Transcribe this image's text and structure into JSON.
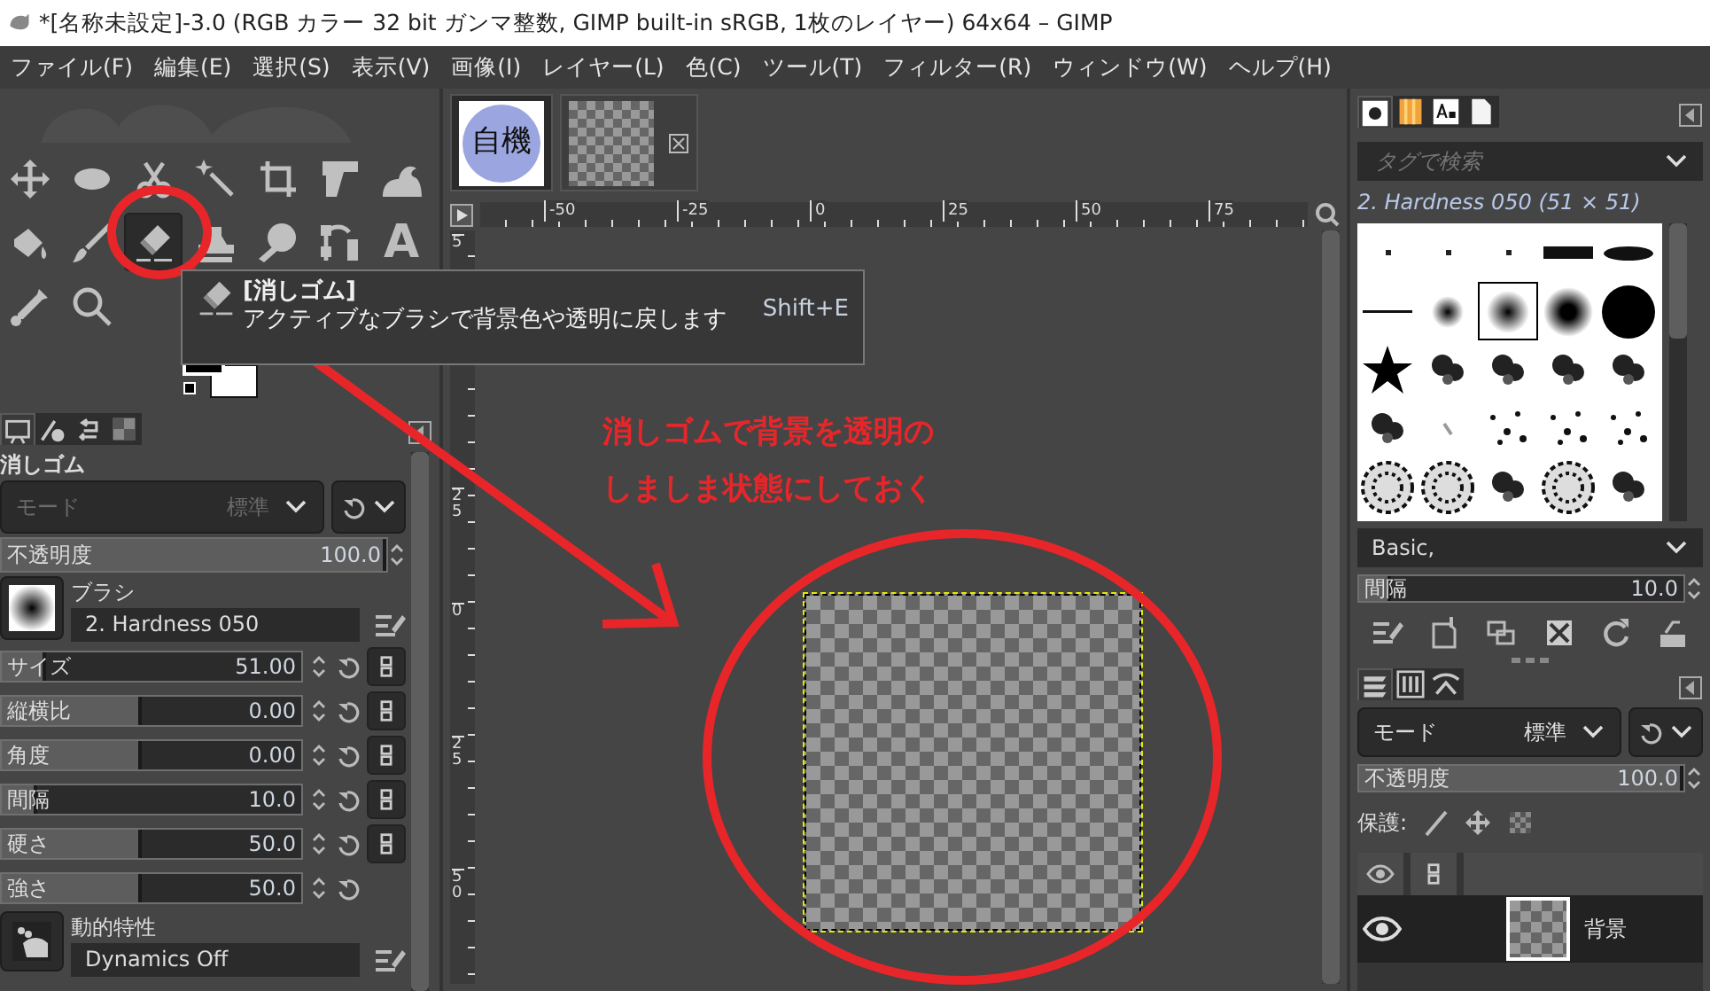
{
  "window": {
    "title": "*[名称未設定]-3.0 (RGB カラー 32 bit ガンマ整数, GIMP built-in sRGB, 1枚のレイヤー) 64x64 – GIMP"
  },
  "menu": [
    "ファイル(F)",
    "編集(E)",
    "選択(S)",
    "表示(V)",
    "画像(I)",
    "レイヤー(L)",
    "色(C)",
    "ツール(T)",
    "フィルター(R)",
    "ウィンドウ(W)",
    "ヘルプ(H)"
  ],
  "toolbox": {
    "tools": [
      {
        "kind": "move",
        "selected": false
      },
      {
        "kind": "ellipse",
        "selected": false
      },
      {
        "kind": "scissors",
        "selected": false
      },
      {
        "kind": "wand",
        "selected": false
      },
      {
        "kind": "crop",
        "selected": false
      },
      {
        "kind": "transform",
        "selected": false
      },
      {
        "kind": "warp",
        "selected": false
      },
      {
        "kind": "bucket",
        "selected": false
      },
      {
        "kind": "brush",
        "selected": false
      },
      {
        "kind": "eraser",
        "selected": true
      },
      {
        "kind": "clone",
        "selected": false
      },
      {
        "kind": "smudge",
        "selected": false
      },
      {
        "kind": "paths",
        "selected": false
      },
      {
        "kind": "text",
        "glyph": "A",
        "selected": false
      },
      {
        "kind": "picker",
        "selected": false
      },
      {
        "kind": "zoom",
        "selected": false
      }
    ]
  },
  "tooltip": {
    "title": "[消しゴム]",
    "description": "アクティブなブラシで背景色や透明に戻します",
    "shortcut": "Shift+E"
  },
  "tool_options": {
    "tabs": [
      {
        "kind": "options",
        "selected": true
      },
      {
        "kind": "device",
        "selected": false
      },
      {
        "kind": "undo",
        "selected": false
      },
      {
        "kind": "images",
        "selected": false
      }
    ],
    "title": "消しゴム",
    "mode": {
      "label": "モード",
      "value": "標準",
      "disabled": true
    },
    "opacity": {
      "label": "不透明度",
      "value": "100.0",
      "level": 1
    },
    "brush": {
      "label": "ブラシ",
      "value": "2. Hardness 050"
    },
    "sliders": [
      {
        "label": "サイズ",
        "value": "51.00",
        "level": 0.15,
        "linked": true
      },
      {
        "label": "縦横比",
        "value": "0.00",
        "level": 0.47,
        "linked": true
      },
      {
        "label": "角度",
        "value": "0.00",
        "level": 0.47,
        "linked": true
      },
      {
        "label": "間隔",
        "value": "10.0",
        "level": 0.12,
        "linked": true
      },
      {
        "label": "硬さ",
        "value": "50.0",
        "level": 0.47,
        "linked": true
      },
      {
        "label": "強さ",
        "value": "50.0",
        "level": 0.47,
        "linked": false
      }
    ],
    "dynamics": {
      "label": "動的特性",
      "value": "Dynamics Off"
    }
  },
  "images": [
    {
      "kind": "logo",
      "label": "自機",
      "selected": true
    },
    {
      "kind": "transparent",
      "selected": false
    }
  ],
  "rulers": {
    "horizontal": [
      "-50",
      "-25",
      "0",
      "25",
      "50",
      "75"
    ],
    "vertical": [
      "5",
      "25",
      "0",
      "25",
      "50"
    ]
  },
  "annotation": {
    "lines": [
      "消しゴムで背景を透明の",
      "しましま状態にしておく"
    ]
  },
  "brushes_panel": {
    "tabs": [
      {
        "kind": "brushes",
        "selected": true
      },
      {
        "kind": "gradients",
        "selected": false
      },
      {
        "kind": "fonts",
        "selected": false
      },
      {
        "kind": "documents",
        "selected": false
      }
    ],
    "search": {
      "placeholder": "タグで検索"
    },
    "brush_title": "2. Hardness 050 (51 × 51)",
    "brushes": [
      {
        "kind": "pixel",
        "selected": false
      },
      {
        "kind": "pixel",
        "selected": false
      },
      {
        "kind": "pixel",
        "selected": false
      },
      {
        "kind": "block",
        "selected": false
      },
      {
        "kind": "ellipse",
        "selected": false
      },
      {
        "kind": "line",
        "selected": false
      },
      {
        "kind": "soft-small",
        "selected": false
      },
      {
        "kind": "soft-medium",
        "selected": true
      },
      {
        "kind": "soft-large",
        "selected": false
      },
      {
        "kind": "hard",
        "selected": false
      },
      {
        "kind": "star",
        "selected": false
      },
      {
        "kind": "texture",
        "selected": false
      },
      {
        "kind": "texture",
        "selected": false
      },
      {
        "kind": "texture",
        "selected": false
      },
      {
        "kind": "texture",
        "selected": false
      },
      {
        "kind": "texture",
        "selected": false
      },
      {
        "kind": "stroke",
        "selected": false
      },
      {
        "kind": "scatter",
        "selected": false
      },
      {
        "kind": "scatter",
        "selected": false
      },
      {
        "kind": "scatter",
        "selected": false
      },
      {
        "kind": "cells",
        "selected": false
      },
      {
        "kind": "cells",
        "selected": false
      },
      {
        "kind": "texture",
        "selected": false
      },
      {
        "kind": "cells",
        "selected": false
      },
      {
        "kind": "texture",
        "selected": false
      }
    ],
    "tag": "Basic,",
    "spacing": {
      "label": "間隔",
      "value": "10.0",
      "level": 0.1
    }
  },
  "layers_panel": {
    "tabs": [
      {
        "kind": "layers",
        "selected": true
      },
      {
        "kind": "channels",
        "selected": false
      },
      {
        "kind": "paths",
        "selected": false
      }
    ],
    "mode": {
      "label": "モード",
      "value": "標準"
    },
    "opacity": {
      "label": "不透明度",
      "value": "100.0",
      "level": 1
    },
    "lock_label": "保護:",
    "layers": [
      {
        "name": "背景",
        "visible": true
      }
    ]
  }
}
